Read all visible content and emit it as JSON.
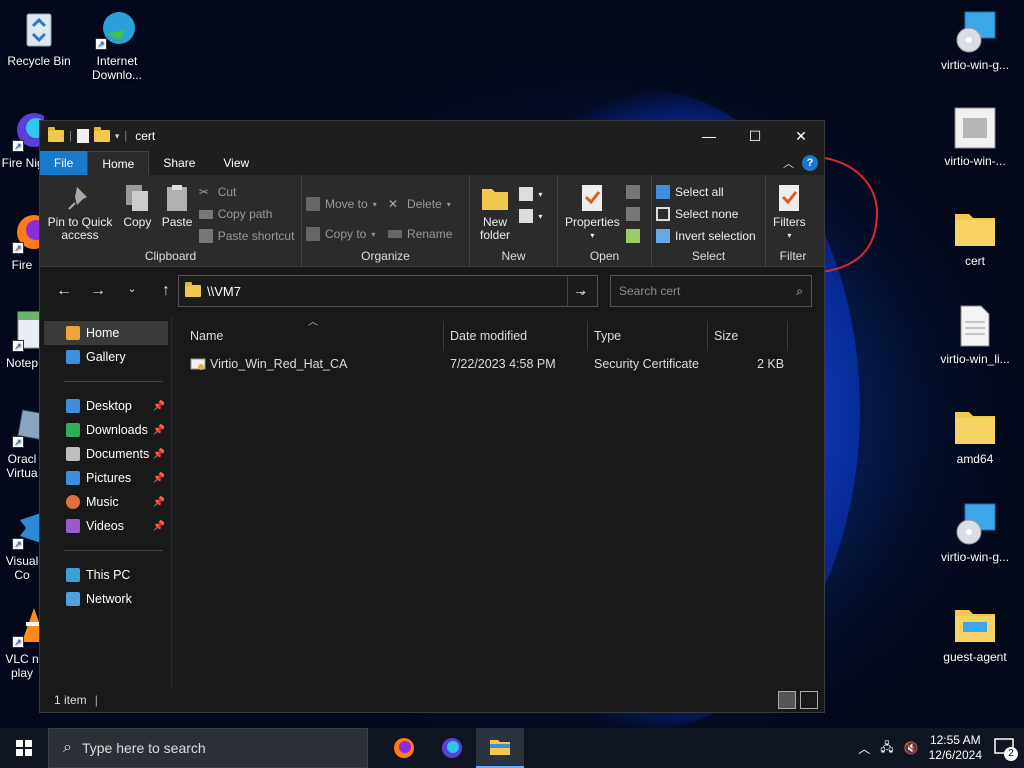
{
  "desktop": {
    "left_icons": [
      {
        "label": "Recycle Bin"
      },
      {
        "label": "Internet Downlo..."
      },
      {
        "label": "Fire Nigh"
      },
      {
        "label": "Fire"
      },
      {
        "label": "Notep"
      },
      {
        "label": "Oracl Virtua"
      },
      {
        "label": "Visual Co"
      },
      {
        "label": "VLC n play"
      }
    ],
    "right_icons": [
      {
        "label": "virtio-win-g..."
      },
      {
        "label": "virtio-win-..."
      },
      {
        "label": "cert"
      },
      {
        "label": "virtio-win_li..."
      },
      {
        "label": "amd64"
      },
      {
        "label": "virtio-win-g..."
      },
      {
        "label": "guest-agent"
      }
    ]
  },
  "window": {
    "title": "cert",
    "controls": {
      "minimize": "—",
      "maximize": "☐",
      "close": "✕"
    },
    "tabs": [
      "File",
      "Home",
      "Share",
      "View"
    ],
    "help": "?",
    "ribbon": {
      "clipboard": {
        "label": "Clipboard",
        "pin": "Pin to Quick access",
        "copy": "Copy",
        "paste": "Paste",
        "cut": "Cut",
        "copy_path": "Copy path",
        "paste_shortcut": "Paste shortcut"
      },
      "organize": {
        "label": "Organize",
        "move_to": "Move to",
        "copy_to": "Copy to",
        "delete": "Delete",
        "rename": "Rename"
      },
      "new": {
        "label": "New",
        "new_folder": "New folder"
      },
      "open": {
        "label": "Open",
        "properties": "Properties"
      },
      "select": {
        "label": "Select",
        "select_all": "Select all",
        "select_none": "Select none",
        "invert": "Invert selection"
      },
      "filter": {
        "label": "Filter",
        "filters": "Filters"
      }
    },
    "address": {
      "value": "\\\\VM7"
    },
    "search": {
      "placeholder": "Search cert"
    },
    "nav_pane": {
      "home": "Home",
      "gallery": "Gallery",
      "quick": [
        {
          "label": "Desktop",
          "color": "#3b8ee0"
        },
        {
          "label": "Downloads",
          "color": "#2fae5a"
        },
        {
          "label": "Documents",
          "color": "#bdbdbd"
        },
        {
          "label": "Pictures",
          "color": "#3b8ee0"
        },
        {
          "label": "Music",
          "color": "#e0703b"
        },
        {
          "label": "Videos",
          "color": "#9b59d0"
        }
      ],
      "this_pc": "This PC",
      "network": "Network"
    },
    "columns": {
      "name": "Name",
      "date": "Date modified",
      "type": "Type",
      "size": "Size"
    },
    "files": [
      {
        "name": "Virtio_Win_Red_Hat_CA",
        "date": "7/22/2023 4:58 PM",
        "type": "Security Certificate",
        "size": "2 KB"
      }
    ],
    "status": "1 item"
  },
  "taskbar": {
    "search_placeholder": "Type here to search",
    "time": "12:55 AM",
    "date": "12/6/2024",
    "notifications": "2"
  },
  "colors": {
    "accent": "#1979ca",
    "annotation": "#d9262f"
  }
}
